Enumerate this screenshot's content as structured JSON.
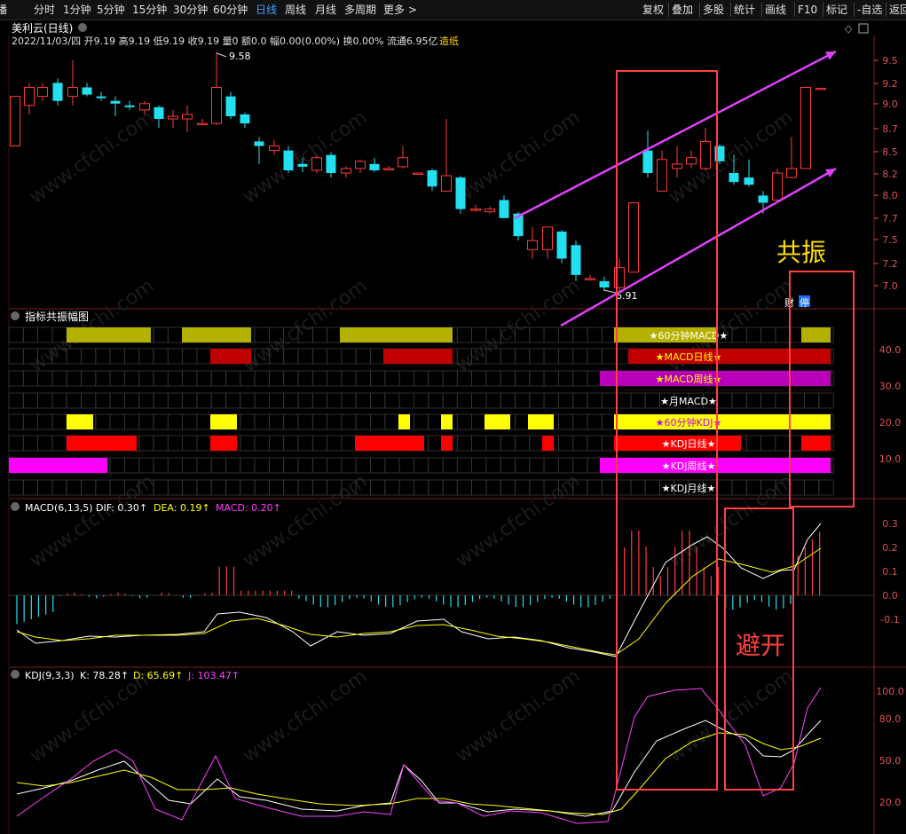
{
  "toolbar": {
    "left": [
      "播",
      "分时",
      "1分钟",
      "5分钟",
      "15分钟",
      "30分钟",
      "60分钟",
      "日线",
      "周线",
      "月线",
      "多周期",
      "更多 >"
    ],
    "active": "日线",
    "right": [
      "复权",
      "叠加",
      "多股",
      "统计",
      "画线",
      "F10",
      "标记",
      "-自选",
      "返回"
    ]
  },
  "stock": {
    "title": "美利云(日线)",
    "info_prefix": "2022/11/03/四 开9.19 高9.19 低9.19 收9.19 量0 额0.0 幅0.00(0.00%) 换0.00% 流通6.95亿",
    "sector": "造纸",
    "high_label": "9.58",
    "low_label": "6.91",
    "y_ticks": [
      "9.5",
      "9.2",
      "9.0",
      "8.7",
      "8.5",
      "8.2",
      "8.0",
      "7.7",
      "7.5",
      "7.2",
      "7.0"
    ],
    "tags": [
      "财",
      "停"
    ]
  },
  "resonance_panel": {
    "title": "指标共振幅图",
    "rows": [
      "★60分钟MACD★",
      "★MACD日线★",
      "★MACD周线★",
      "★月MACD★",
      "★60分钟KDJ★",
      "★KDJ日线★",
      "★KDJ周线★",
      "★KDJ月线★"
    ],
    "y_ticks": [
      "40.0",
      "30.0",
      "20.0",
      "10.0"
    ]
  },
  "macd": {
    "title": "MACD(6,13,5)",
    "dif": "DIF: 0.30",
    "dea": "DEA: 0.19",
    "macd": "MACD: 0.20",
    "y_ticks": [
      "0.3",
      "0.2",
      "0.1",
      "0.0",
      "-0.1"
    ]
  },
  "kdj": {
    "title": "KDJ(9,3,3)",
    "k": "K: 78.28",
    "d": "D: 65.69",
    "j": "J: 103.47",
    "y_ticks": [
      "100.0",
      "80.0",
      "50.0",
      "20.0"
    ]
  },
  "annotations": {
    "resonance": "共振",
    "avoid": "避开"
  },
  "watermark": "www.cfchi.com",
  "colors": {
    "up": "#ff3a3a",
    "down": "#22e0f0",
    "macd_row": "#b3b000",
    "macd_day": "#c00000",
    "macd_week": "#b800b8",
    "kdj60": "#ffff00",
    "kdj_day": "#ff0000",
    "kdj_week": "#ff00ff",
    "arrow": "#e040fb",
    "box": "#ff4040",
    "annot_yellow": "#ffe000"
  }
}
